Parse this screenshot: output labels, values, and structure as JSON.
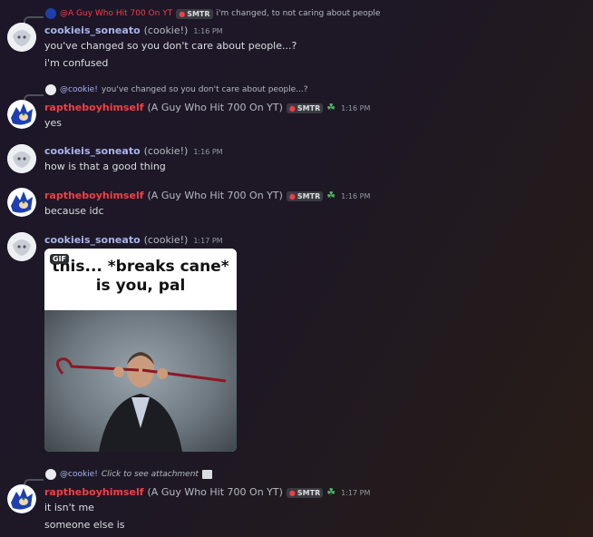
{
  "colors": {
    "cookie_name": "#a9b4e8",
    "zap_name": "#f23f43",
    "text": "#dbdee1",
    "muted": "#949ba4"
  },
  "reply1": {
    "author": "@A Guy Who Hit 700 On YT",
    "tag": "SMTR",
    "text": "i'm changed, to not caring about people"
  },
  "msg1": {
    "name": "cookieis_soneato",
    "nick": "(cookie!)",
    "time": "1:16 PM",
    "line1": "you've changed so you don't care about people...?",
    "line2": "i'm confused"
  },
  "reply2": {
    "author": "@cookie!",
    "text": "you've changed so you don't care about people...?"
  },
  "msg2": {
    "name": "raptheboyhimself",
    "nick": "(A Guy Who Hit 700 On YT)",
    "tag": "SMTR",
    "time": "1:16 PM",
    "line1": "yes"
  },
  "msg3": {
    "name": "cookieis_soneato",
    "nick": "(cookie!)",
    "time": "1:16 PM",
    "line1": "how is that a good thing"
  },
  "msg4": {
    "name": "raptheboyhimself",
    "nick": "(A Guy Who Hit 700 On YT)",
    "tag": "SMTR",
    "time": "1:16 PM",
    "line1": "because idc"
  },
  "msg5": {
    "name": "cookieis_soneato",
    "nick": "(cookie!)",
    "time": "1:17 PM",
    "gif_label": "GIF",
    "gif_caption_line1": "this... *breaks cane*",
    "gif_caption_line2": "is you, pal"
  },
  "reply3": {
    "author": "@cookie!",
    "text": "Click to see attachment"
  },
  "msg6": {
    "name": "raptheboyhimself",
    "nick": "(A Guy Who Hit 700 On YT)",
    "tag": "SMTR",
    "time": "1:17 PM",
    "line1": "it isn't me",
    "line2": "someone else is"
  }
}
